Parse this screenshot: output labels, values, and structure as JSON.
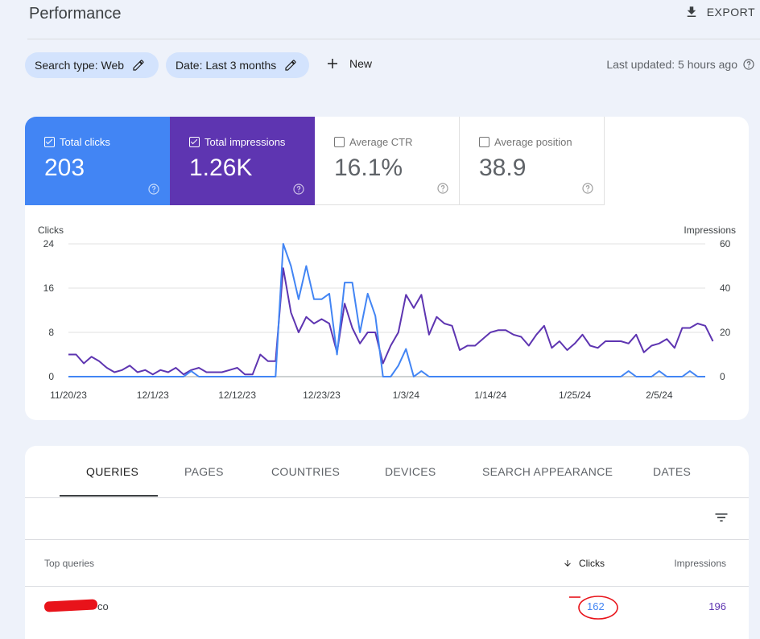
{
  "header": {
    "title": "Performance",
    "export_label": "EXPORT"
  },
  "filters": {
    "search_type": "Search type: Web",
    "date": "Date: Last 3 months",
    "new_label": "New",
    "last_updated": "Last updated: 5 hours ago"
  },
  "metrics": [
    {
      "label": "Total clicks",
      "value": "203",
      "checked": true,
      "color": "#4285f4"
    },
    {
      "label": "Total impressions",
      "value": "1.26K",
      "checked": true,
      "color": "#5e35b1"
    },
    {
      "label": "Average CTR",
      "value": "16.1%",
      "checked": false
    },
    {
      "label": "Average position",
      "value": "38.9",
      "checked": false
    }
  ],
  "chart_data": {
    "type": "line",
    "left_axis_label": "Clicks",
    "right_axis_label": "Impressions",
    "left_ticks": [
      "24",
      "16",
      "8",
      "0"
    ],
    "right_ticks": [
      "60",
      "40",
      "20",
      "0"
    ],
    "ylim_left": [
      0,
      24
    ],
    "ylim_right": [
      0,
      60
    ],
    "x_tick_labels": [
      "11/20/23",
      "12/1/23",
      "12/12/23",
      "12/23/23",
      "1/3/24",
      "1/14/24",
      "1/25/24",
      "2/5/24"
    ],
    "x_tick_index": [
      0,
      11,
      22,
      33,
      44,
      55,
      66,
      77
    ],
    "series": [
      {
        "name": "Clicks",
        "axis": "left",
        "color": "#4285f4",
        "values": [
          0,
          0,
          0,
          0,
          0,
          0,
          0,
          0,
          0,
          0,
          0,
          0,
          0,
          0,
          0,
          0,
          1,
          0,
          0,
          0,
          0,
          0,
          0,
          0,
          0,
          0,
          0,
          0,
          24,
          20,
          14,
          20,
          14,
          14,
          15,
          4,
          17,
          17,
          8,
          15,
          11,
          0,
          0,
          2,
          5,
          0,
          1,
          0,
          0,
          0,
          0,
          0,
          0,
          0,
          0,
          0,
          0,
          0,
          0,
          0,
          0,
          0,
          0,
          0,
          0,
          0,
          0,
          0,
          0,
          0,
          0,
          0,
          0,
          1,
          0,
          0,
          0,
          1,
          0,
          0,
          0,
          1,
          0,
          0
        ]
      },
      {
        "name": "Impressions",
        "axis": "right",
        "color": "#5e35b1",
        "values": [
          10,
          10,
          6,
          9,
          7,
          4,
          2,
          3,
          5,
          2,
          3,
          1,
          3,
          2,
          4,
          1,
          3,
          4,
          2,
          2,
          2,
          3,
          4,
          1,
          1,
          10,
          7,
          7,
          49,
          29,
          20,
          27,
          24,
          26,
          24,
          11,
          33,
          22,
          15,
          20,
          20,
          6,
          14,
          20,
          37,
          31,
          37,
          19,
          27,
          24,
          23,
          12,
          14,
          14,
          17,
          20,
          21,
          21,
          19,
          18,
          14,
          19,
          23,
          13,
          16,
          12,
          15,
          19,
          14,
          13,
          16,
          16,
          16,
          15,
          19,
          11,
          14,
          15,
          17,
          13,
          22,
          22,
          24,
          23,
          16
        ]
      }
    ]
  },
  "table": {
    "tabs": [
      "QUERIES",
      "PAGES",
      "COUNTRIES",
      "DEVICES",
      "SEARCH APPEARANCE",
      "DATES"
    ],
    "columns": {
      "query": "Top queries",
      "clicks": "Clicks",
      "impressions": "Impressions"
    },
    "rows": [
      {
        "query_suffix": "co",
        "clicks": "162",
        "impressions": "196"
      }
    ]
  }
}
